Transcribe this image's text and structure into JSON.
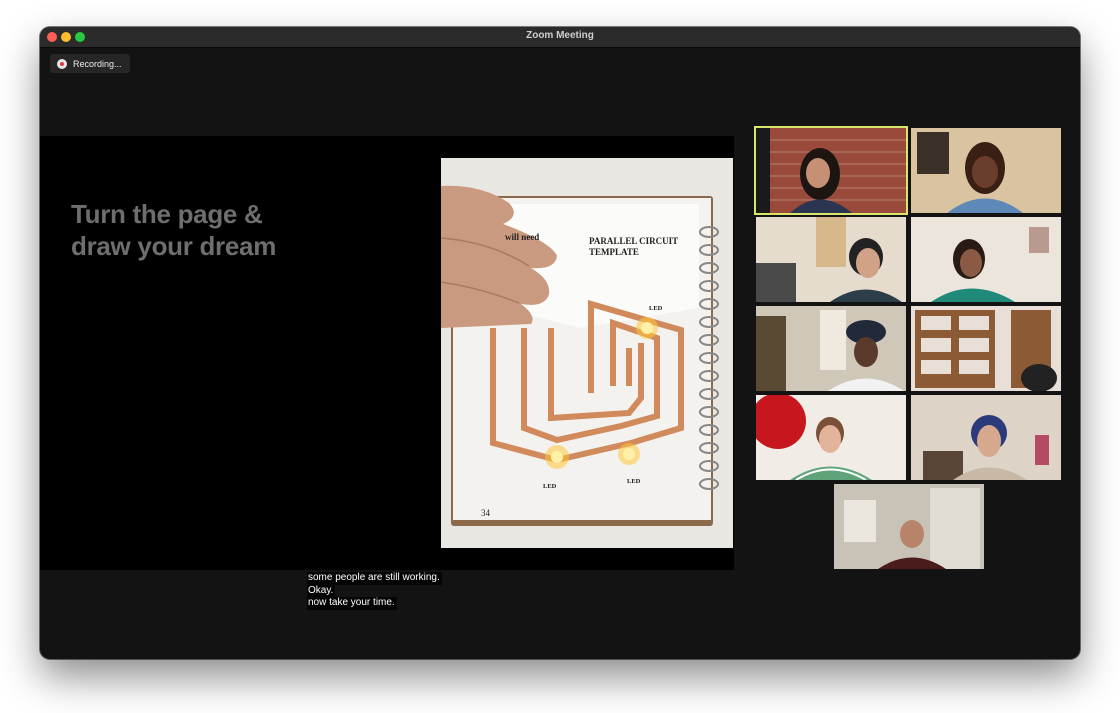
{
  "window": {
    "title": "Zoom Meeting"
  },
  "recording": {
    "label": "Recording..."
  },
  "slide": {
    "line1": "Turn the page &",
    "line2": "draw your dream"
  },
  "photo": {
    "you_will_need": "will need",
    "template_line1": "PARALLEL CIRCUIT",
    "template_line2": "TEMPLATE",
    "led_top": "LED",
    "led_bottom_left": "LED",
    "led_bottom_right": "LED",
    "page_number": "34"
  },
  "captions": [
    "some people are still working.",
    "Okay.",
    "now take your time."
  ],
  "participants_count": 9,
  "colors": {
    "active_speaker_border": "#d7e56a",
    "copper_tape": "#d08a5c",
    "led_glow": "#ffc83a"
  }
}
